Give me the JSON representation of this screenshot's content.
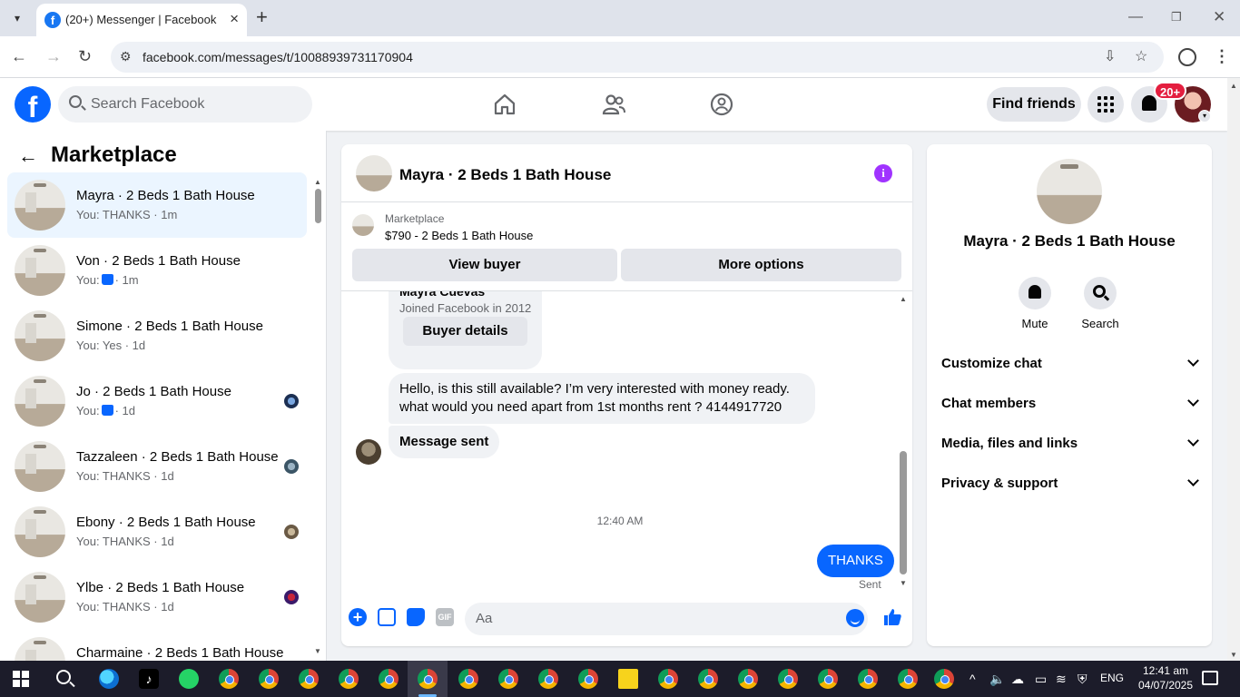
{
  "browser": {
    "tab_title": "(20+) Messenger | Facebook",
    "url": "facebook.com/messages/t/10088939731170904"
  },
  "fb_header": {
    "search_placeholder": "Search Facebook",
    "find_friends_label": "Find friends",
    "notification_badge": "20+"
  },
  "sidebar": {
    "title": "Marketplace",
    "conversations": [
      {
        "name": "Mayra · 2 Beds 1 Bath House",
        "subtitle": "You: THANKS · 1m",
        "active": true
      },
      {
        "name": "Von · 2 Beds 1 Bath House",
        "subtitle_prefix": "You:",
        "subtitle_suffix": "· 1m",
        "has_like": true
      },
      {
        "name": "Simone · 2 Beds 1 Bath House",
        "subtitle": "You: Yes · 1d"
      },
      {
        "name": "Jo · 2 Beds 1 Bath House",
        "subtitle_prefix": "You:",
        "subtitle_suffix": "· 1d",
        "has_like": true
      },
      {
        "name": "Tazzaleen · 2 Beds 1 Bath House",
        "subtitle": "You: THANKS · 1d"
      },
      {
        "name": "Ebony · 2 Beds 1 Bath House",
        "subtitle": "You: THANKS · 1d"
      },
      {
        "name": "Ylbe · 2 Beds 1 Bath House",
        "subtitle": "You: THANKS · 1d"
      },
      {
        "name": "Charmaine · 2 Beds 1 Bath House",
        "subtitle": ""
      }
    ]
  },
  "chat": {
    "title": "Mayra · 2 Beds 1 Bath House",
    "listing": {
      "source": "Marketplace",
      "title": "$790 - 2 Beds 1 Bath House",
      "view_buyer_label": "View buyer",
      "more_options_label": "More options"
    },
    "buyer_card": {
      "name": "Mayra Cuevas",
      "joined": "Joined Facebook in 2012",
      "button_label": "Buyer details"
    },
    "messages": {
      "incoming_1": "Hello, is this still available? I’m very interested with money ready. what would you need apart from 1st months rent ? 4144917720",
      "incoming_2": "Message sent",
      "timestamp": "12:40 AM",
      "outgoing_1": "THANKS",
      "status": "Sent"
    },
    "composer": {
      "placeholder": "Aa",
      "gif_label": "GIF"
    }
  },
  "info_panel": {
    "name": "Mayra · 2 Beds 1 Bath House",
    "actions": {
      "mute": "Mute",
      "search": "Search"
    },
    "sections": [
      "Customize chat",
      "Chat members",
      "Media, files and links",
      "Privacy & support"
    ]
  },
  "taskbar": {
    "language": "ENG",
    "time": "12:41 am",
    "date": "04/07/2025"
  },
  "colors": {
    "fb_blue": "#0866ff",
    "active_row": "#ebf5ff",
    "badge_red": "#e41e3f",
    "info_purple": "#a033ff"
  }
}
